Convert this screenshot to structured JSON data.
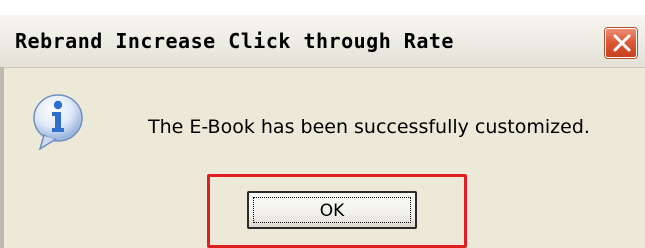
{
  "dialog": {
    "title": "Rebrand Increase Click through Rate",
    "message": "The E-Book has been successfully customized.",
    "icon": "info-icon",
    "ok_label": "OK"
  },
  "colors": {
    "title_bar": "#ecebe3",
    "dialog_background": "#ece9d8",
    "close_button": "#dd5a39",
    "highlight": "#e02020",
    "info_icon": "#2f6fd0"
  }
}
